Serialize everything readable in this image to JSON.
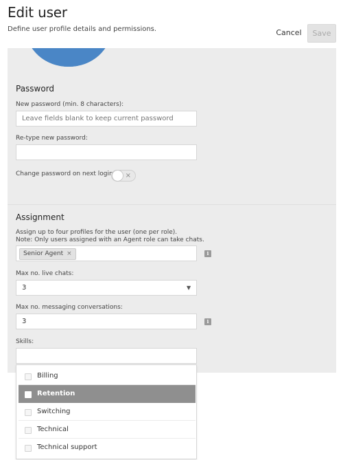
{
  "header": {
    "title": "Edit user",
    "subtitle": "Define user profile details and permissions.",
    "cancel_label": "Cancel",
    "save_label": "Save"
  },
  "password": {
    "section_title": "Password",
    "new_label": "New password (min. 8 characters):",
    "new_placeholder": "Leave fields blank to keep current password",
    "retype_label": "Re-type new password:",
    "retype_value": "",
    "change_on_login_label": "Change password on next login:",
    "change_on_login_enabled": false
  },
  "assignment": {
    "section_title": "Assignment",
    "help_line1": "Assign up to four profiles for the user (one per role).",
    "help_line2": "Note: Only users assigned with an Agent role can take chats.",
    "profiles": [
      "Senior Agent"
    ],
    "max_live_chats_label": "Max no. live chats:",
    "max_live_chats_value": "3",
    "max_messaging_label": "Max no. messaging conversations:",
    "max_messaging_value": "3",
    "skills_label": "Skills:",
    "skills_value": ""
  },
  "skills_dropdown": {
    "options": [
      {
        "label": "Billing",
        "highlighted": false
      },
      {
        "label": "Retention",
        "highlighted": true
      },
      {
        "label": "Switching",
        "highlighted": false
      },
      {
        "label": "Technical",
        "highlighted": false
      },
      {
        "label": "Technical support",
        "highlighted": false
      }
    ]
  },
  "icons": {
    "info": "info-icon",
    "tag_remove": "×",
    "toggle_off": "×",
    "select_arrow": "chevron-down-icon"
  },
  "colors": {
    "panel_bg": "#ececec",
    "highlight_bg": "#8f8f8f",
    "save_disabled_bg": "#e3e3e3"
  }
}
